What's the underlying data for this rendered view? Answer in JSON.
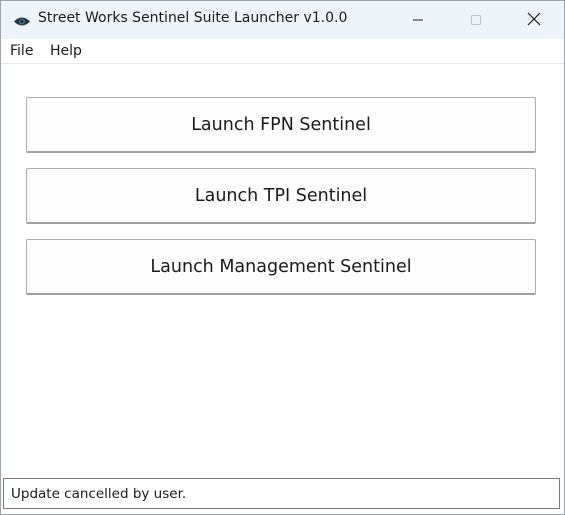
{
  "window": {
    "title": "Street Works Sentinel Suite Launcher v1.0.0",
    "icon": "eye-icon",
    "controls": [
      "minimize-icon",
      "maximize-icon",
      "close-icon"
    ]
  },
  "menu": {
    "file_label": "File",
    "help_label": "Help"
  },
  "main": {
    "buttons": [
      {
        "label": "Launch FPN Sentinel"
      },
      {
        "label": "Launch TPI Sentinel"
      },
      {
        "label": "Launch Management Sentinel"
      }
    ]
  },
  "status": {
    "text": "Update cancelled by user."
  },
  "colors": {
    "titlebar_bg": "#eef4f9",
    "icon_dark": "#1f3545",
    "button_bg": "#fdfdfd",
    "button_border": "#adadad"
  }
}
